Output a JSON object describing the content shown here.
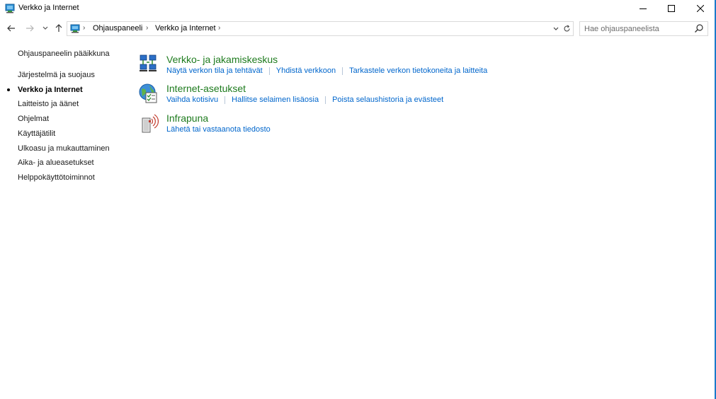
{
  "window": {
    "title": "Verkko ja Internet"
  },
  "address_bar": {
    "breadcrumbs": [
      "Ohjauspaneeli",
      "Verkko ja Internet"
    ]
  },
  "search": {
    "placeholder": "Hae ohjauspaneelista"
  },
  "sidebar": {
    "items": [
      {
        "label": "Ohjauspaneelin pääikkuna",
        "active": false
      },
      {
        "label": "Järjestelmä ja suojaus",
        "active": false
      },
      {
        "label": "Verkko ja Internet",
        "active": true
      },
      {
        "label": "Laitteisto ja äänet",
        "active": false
      },
      {
        "label": "Ohjelmat",
        "active": false
      },
      {
        "label": "Käyttäjätilit",
        "active": false
      },
      {
        "label": "Ulkoasu ja mukauttaminen",
        "active": false
      },
      {
        "label": "Aika- ja alueasetukset",
        "active": false
      },
      {
        "label": "Helppokäyttötoiminnot",
        "active": false
      }
    ]
  },
  "categories": [
    {
      "icon": "network-sharing-center-icon",
      "title": "Verkko- ja jakamiskeskus",
      "links": [
        "Näytä verkon tila ja tehtävät",
        "Yhdistä verkkoon",
        "Tarkastele verkon tietokoneita ja laitteita"
      ]
    },
    {
      "icon": "internet-options-icon",
      "title": "Internet-asetukset",
      "links": [
        "Vaihda kotisivu",
        "Hallitse selaimen lisäosia",
        "Poista selaushistoria ja evästeet"
      ]
    },
    {
      "icon": "infrared-icon",
      "title": "Infrapuna",
      "links": [
        "Lähetä tai vastaanota tiedosto"
      ]
    }
  ],
  "colors": {
    "category_title": "#1e7b1e",
    "link": "#0066cc",
    "window_border": "#1979ca"
  }
}
